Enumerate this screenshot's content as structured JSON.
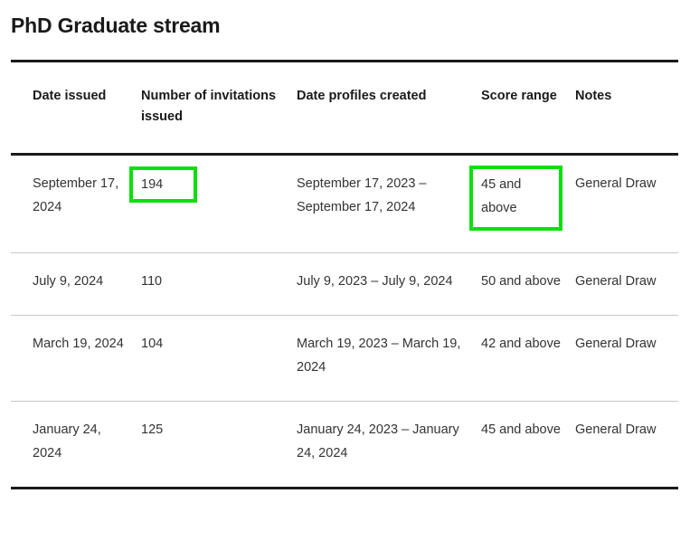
{
  "page": {
    "title": "PhD Graduate stream"
  },
  "table": {
    "headers": [
      "Date issued",
      "Number of invitations issued",
      "Date profiles created",
      "Score range",
      "Notes"
    ],
    "rows": [
      {
        "date_issued": "September 17, 2024",
        "invitations": "194",
        "profiles_created": "September 17, 2023 – September 17, 2024",
        "score_range": "45 and above",
        "notes": "General Draw"
      },
      {
        "date_issued": "July 9, 2024",
        "invitations": "110",
        "profiles_created": "July 9, 2023 – July 9, 2024",
        "score_range": "50 and above",
        "notes": "General Draw"
      },
      {
        "date_issued": "March 19, 2024",
        "invitations": "104",
        "profiles_created": "March 19, 2023 – March 19, 2024",
        "score_range": "42 and above",
        "notes": "General Draw"
      },
      {
        "date_issued": "January 24, 2024",
        "invitations": "125",
        "profiles_created": "January 24, 2023 – January 24, 2024",
        "score_range": "45 and above",
        "notes": "General Draw"
      }
    ]
  },
  "annotations": {
    "highlight_color": "#08e008",
    "highlighted_cells": [
      "row0.invitations",
      "row0.score_range"
    ]
  }
}
